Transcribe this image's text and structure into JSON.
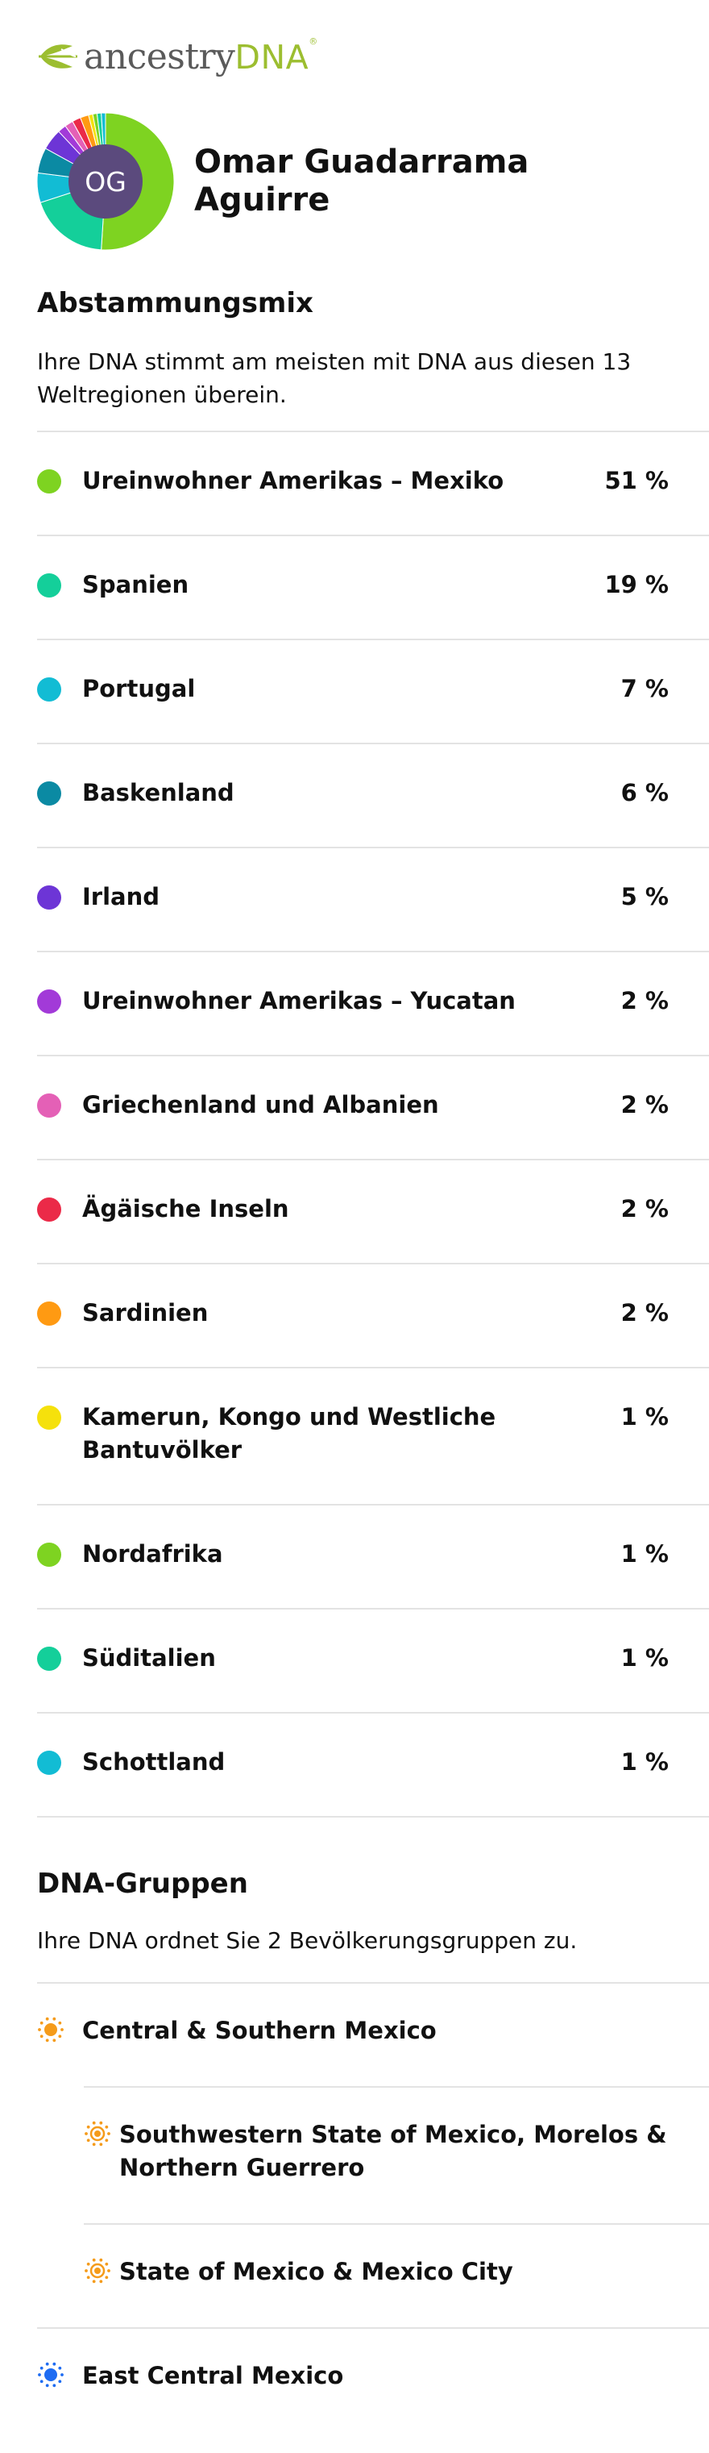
{
  "brand": {
    "text": "ancestry",
    "dna": "DNA",
    "reg": "®"
  },
  "profile": {
    "initials": "OG",
    "name_line1": "Omar Guadarrama",
    "name_line2": "Aguirre"
  },
  "ethnicity": {
    "title": "Abstammungsmix",
    "description": "Ihre DNA stimmt am meisten mit DNA aus diesen 13 Weltregionen überein.",
    "regions": [
      {
        "name": "Ureinwohner Amerikas – Mexiko",
        "percent": "51 %",
        "value": 51,
        "color": "#7ed321"
      },
      {
        "name": "Spanien",
        "percent": "19 %",
        "value": 19,
        "color": "#14cf9a"
      },
      {
        "name": "Portugal",
        "percent": "7 %",
        "value": 7,
        "color": "#12bcd4"
      },
      {
        "name": "Baskenland",
        "percent": "6 %",
        "value": 6,
        "color": "#0b8aa3"
      },
      {
        "name": "Irland",
        "percent": "5 %",
        "value": 5,
        "color": "#6d35d6"
      },
      {
        "name": "Ureinwohner Amerikas – Yucatan",
        "percent": "2 %",
        "value": 2,
        "color": "#a23ad8"
      },
      {
        "name": "Griechenland und Albanien",
        "percent": "2 %",
        "value": 2,
        "color": "#e460b6"
      },
      {
        "name": "Ägäische Inseln",
        "percent": "2 %",
        "value": 2,
        "color": "#eb2a48"
      },
      {
        "name": "Sardinien",
        "percent": "2 %",
        "value": 2,
        "color": "#ff9a12"
      },
      {
        "name": "Kamerun, Kongo und Westliche Bantuvölker",
        "percent": "1 %",
        "value": 1,
        "color": "#f5e10c"
      },
      {
        "name": "Nordafrika",
        "percent": "1 %",
        "value": 1,
        "color": "#7ed321"
      },
      {
        "name": "Süditalien",
        "percent": "1 %",
        "value": 1,
        "color": "#14cf9a"
      },
      {
        "name": "Schottland",
        "percent": "1 %",
        "value": 1,
        "color": "#12bcd4"
      }
    ]
  },
  "groups": {
    "title": "DNA-Gruppen",
    "description": "Ihre DNA ordnet Sie 2 Bevölkerungsgruppen zu.",
    "items": [
      {
        "name": "Central & Southern Mexico",
        "level": 0,
        "icon": "sun-icon-orange",
        "color": "#f59b1a"
      },
      {
        "name": "Southwestern State of Mexico, Morelos & Northern Guerrero",
        "level": 1,
        "icon": "sun-outline-icon-orange",
        "color": "#f59b1a"
      },
      {
        "name": "State of Mexico & Mexico City",
        "level": 1,
        "icon": "sun-outline-icon-orange",
        "color": "#f59b1a"
      },
      {
        "name": "East Central Mexico",
        "level": 0,
        "icon": "sun-icon-blue",
        "color": "#1e6cf2"
      }
    ]
  }
}
